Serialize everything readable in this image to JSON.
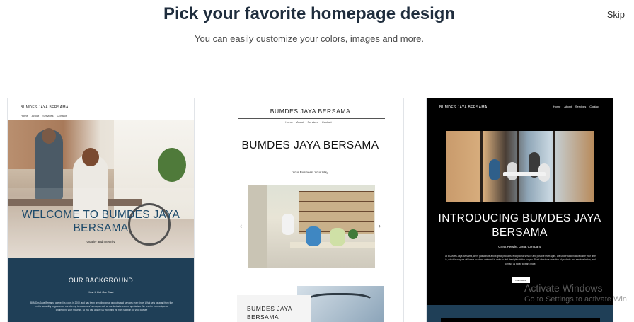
{
  "header": {
    "title": "Pick your favorite homepage design",
    "subtitle": "You can easily customize your colors, images and more.",
    "skip_label": "Skip"
  },
  "templates": [
    {
      "brand": "BUMDES JAYA BERSAMA",
      "nav": [
        "Home",
        "About",
        "Services",
        "Contact"
      ],
      "hero_title": "WELCOME TO BUMDES JAYA BERSAMA",
      "hero_tagline": "Quality and Integrity",
      "section_title": "OUR BACKGROUND",
      "section_subtitle": "How it Got Our Start",
      "section_text": "BUMDes Jaya Bersama opened its doors in 2000, and has been providing great products and services ever since. What sets us apart from the rest is our ability to guarantee our offering to customers' needs, as well as our fantastic team of specialists. We receive from unique or challenging your requests, so you can assure us you'll find the right solution for you. Browse"
    },
    {
      "brand": "BUMDES JAYA BERSAMA",
      "nav": [
        "Home",
        "About",
        "Services",
        "Contact"
      ],
      "hero_title": "BUMDES JAYA BERSAMA",
      "hero_tagline": "Your Business, Your Way",
      "lower_card_title": "BUMDES JAYA BERSAMA",
      "prev_arrow": "‹",
      "next_arrow": "›"
    },
    {
      "brand": "BUMDES JAYA BERSAMA",
      "nav": [
        "Home",
        "About",
        "Services",
        "Contact"
      ],
      "hero_title": "INTRODUCING BUMDES JAYA BERSAMA",
      "hero_tagline": "Great People, Great Company",
      "hero_text": "At BUMDes Jaya Bersama, we're passionate about great products, exceptional service and positive team spirit. We understand how valuable your time is, which is why we will leave no stone unturned in order to find the right solution for you. Read about our selection of products and services below, and contact us today to learn more.",
      "button_label": "Learn More"
    }
  ],
  "watermark": {
    "line1": "Activate Windows",
    "line2": "Go to Settings to activate Win"
  },
  "colors": {
    "title": "#1f2d3d",
    "section_dark_blue": "#1f3f57",
    "card_border": "#e1e4e8",
    "hero_title_blue": "#1d4a6a"
  }
}
